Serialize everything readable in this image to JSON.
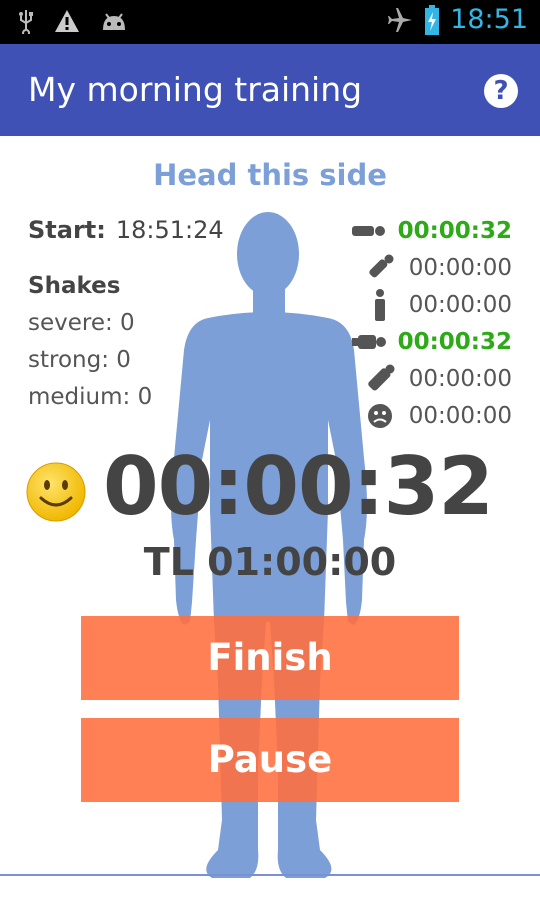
{
  "status_bar": {
    "time": "18:51",
    "icons": [
      "usb-icon",
      "warning-icon",
      "android-icon",
      "airplane-icon",
      "battery-icon"
    ]
  },
  "app_bar": {
    "title": "My morning training",
    "help_icon": "help-icon"
  },
  "main": {
    "side_label": "Head this side",
    "start_label": "Start:",
    "start_value": "18:51:24",
    "shakes_title": "Shakes",
    "shakes": [
      "severe: 0",
      "strong: 0",
      "medium: 0"
    ],
    "timers": [
      {
        "icon": "lying-icon",
        "value": "00:00:32",
        "active": true
      },
      {
        "icon": "tilt-icon",
        "value": "00:00:00",
        "active": false
      },
      {
        "icon": "standing-icon",
        "value": "00:00:00",
        "active": false
      },
      {
        "icon": "lying-wide-icon",
        "value": "00:00:32",
        "active": true
      },
      {
        "icon": "tilt-alt-icon",
        "value": "00:00:00",
        "active": false
      },
      {
        "icon": "sad-face-icon",
        "value": "00:00:00",
        "active": false
      }
    ],
    "big_timer": "00:00:32",
    "time_limit": "TL 01:00:00",
    "finish_label": "Finish",
    "pause_label": "Pause"
  },
  "colors": {
    "app_bar": "#3f51b5",
    "accent_text": "#7b9fd6",
    "active_green": "#2eaa19",
    "button": "#ff6e3c",
    "body_silhouette": "#7b9fd6"
  }
}
